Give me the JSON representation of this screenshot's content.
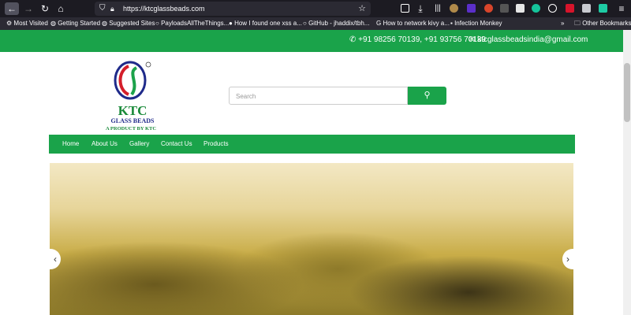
{
  "browser": {
    "url": "https://ktcglassbeads.com",
    "bookmarks": [
      "Most Visited",
      "Getting Started",
      "Suggested Sites",
      "PayloadsAllTheThings...",
      "How I found one xss a...",
      "GitHub - jhaddix/tbh...",
      "How to network kivy a...",
      "Infection Monkey"
    ],
    "other_bookmarks": "Other Bookmarks"
  },
  "topbar": {
    "phone": "+91 98256 70139, +91 93756 70139",
    "email": "ktcglassbeadsindia@gmail.com"
  },
  "logo": {
    "name": "KTC",
    "sub": "GLASS BEADS",
    "tagline": "A PRODUCT BY KTC"
  },
  "search": {
    "placeholder": "Search"
  },
  "nav": [
    "Home",
    "About Us",
    "Gallery",
    "Contact Us",
    "Products"
  ]
}
